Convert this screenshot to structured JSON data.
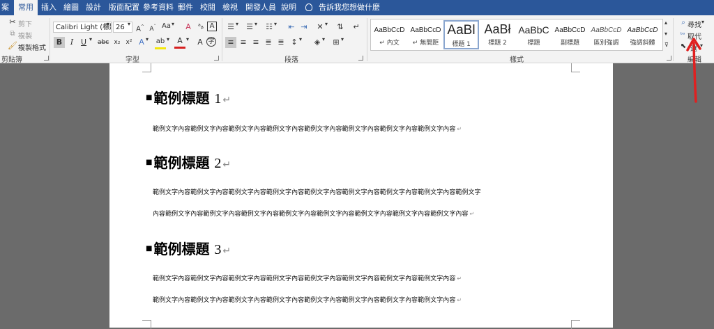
{
  "tabs": [
    {
      "label": "案",
      "active": false
    },
    {
      "label": "常用",
      "active": true
    },
    {
      "label": "插入",
      "active": false
    },
    {
      "label": "繪圖",
      "active": false
    },
    {
      "label": "設計",
      "active": false
    },
    {
      "label": "版面配置",
      "active": false
    },
    {
      "label": "參考資料",
      "active": false
    },
    {
      "label": "郵件",
      "active": false
    },
    {
      "label": "校閱",
      "active": false
    },
    {
      "label": "檢視",
      "active": false
    },
    {
      "label": "開發人員",
      "active": false
    },
    {
      "label": "說明",
      "active": false
    }
  ],
  "tell_me": "告訴我您想做什麼",
  "clipboard": {
    "cut": "剪下",
    "copy": "複製",
    "format_painter": "複製格式",
    "label": "剪貼簿"
  },
  "font": {
    "name": "Calibri Light (標題",
    "size": "26",
    "change_case": "Aa",
    "label": "字型"
  },
  "paragraph": {
    "label": "段落"
  },
  "styles": {
    "label": "樣式",
    "items": [
      {
        "preview": "AaBbCcD",
        "name": "↵ 內文"
      },
      {
        "preview": "AaBbCcD",
        "name": "↵ 無間距"
      },
      {
        "preview": "AaBl",
        "name": "標題 1"
      },
      {
        "preview": "AaBł",
        "name": "標題 2"
      },
      {
        "preview": "AaBbC",
        "name": "標題"
      },
      {
        "preview": "AaBbCcD",
        "name": "副標題"
      },
      {
        "preview": "AaBbCcD",
        "name": "區別強調"
      },
      {
        "preview": "AaBbCcD",
        "name": "強調斜體"
      }
    ]
  },
  "editing": {
    "find": "尋找",
    "replace": "取代",
    "select": "選",
    "label": "編輯"
  },
  "document": {
    "headings": [
      {
        "text": "範例標題",
        "num": "1"
      },
      {
        "text": "範例標題",
        "num": "2"
      },
      {
        "text": "範例標題",
        "num": "3"
      }
    ],
    "lines": [
      "範例文字內容範例文字內容範例文字內容範例文字內容範例文字內容範例文字內容範例文字內容範例文字內容",
      "範例文字內容範例文字內容範例文字內容範例文字內容範例文字內容範例文字內容範例文字內容範例文字內容範例文字",
      "內容範例文字內容範例文字內容範例文字內容範例文字內容範例文字內容範例文字內容範例文字內容範例文字內容",
      "範例文字內容範例文字內容範例文字內容範例文字內容範例文字內容範例文字內容範例文字內容範例文字內容",
      "範例文字內容範例文字內容範例文字內容範例文字內容範例文字內容範例文字內容範例文字內容範例文字內容"
    ],
    "para_mark": "↵"
  },
  "colors": {
    "title_bar": "#2b579a",
    "ribbon": "#f3f3f3",
    "annotation": "#e02020",
    "font_color": "#d62020",
    "highlight": "#f4e80a"
  }
}
